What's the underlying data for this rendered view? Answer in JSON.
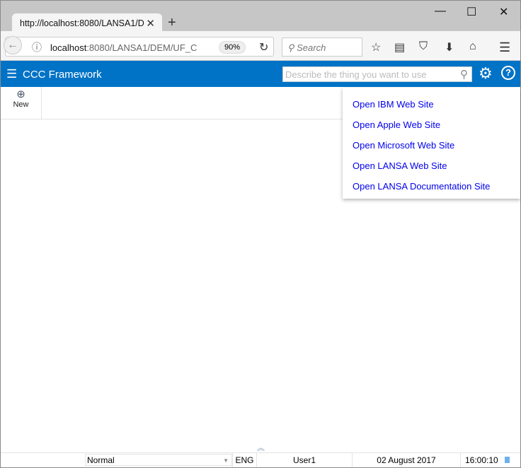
{
  "browser": {
    "tab_title": "http://localhost:8080/LANSA1/D",
    "url_host": "localhost",
    "url_rest": ":8080/LANSA1/DEM/UF_C",
    "zoom": "90%",
    "search_placeholder": "Search"
  },
  "app": {
    "title": "CCC Framework",
    "search_placeholder": "Describe the thing you want to use"
  },
  "toolbar": {
    "new_label": "New"
  },
  "help_menu": [
    "Open IBM Web Site",
    "Open Apple Web Site",
    "Open Microsoft Web Site",
    "Open LANSA Web Site",
    "Open LANSA Documentation Site"
  ],
  "status": {
    "mode": "Normal",
    "language": "ENG",
    "user": "User1",
    "date": "02 August 2017",
    "time": "16:00:10"
  }
}
